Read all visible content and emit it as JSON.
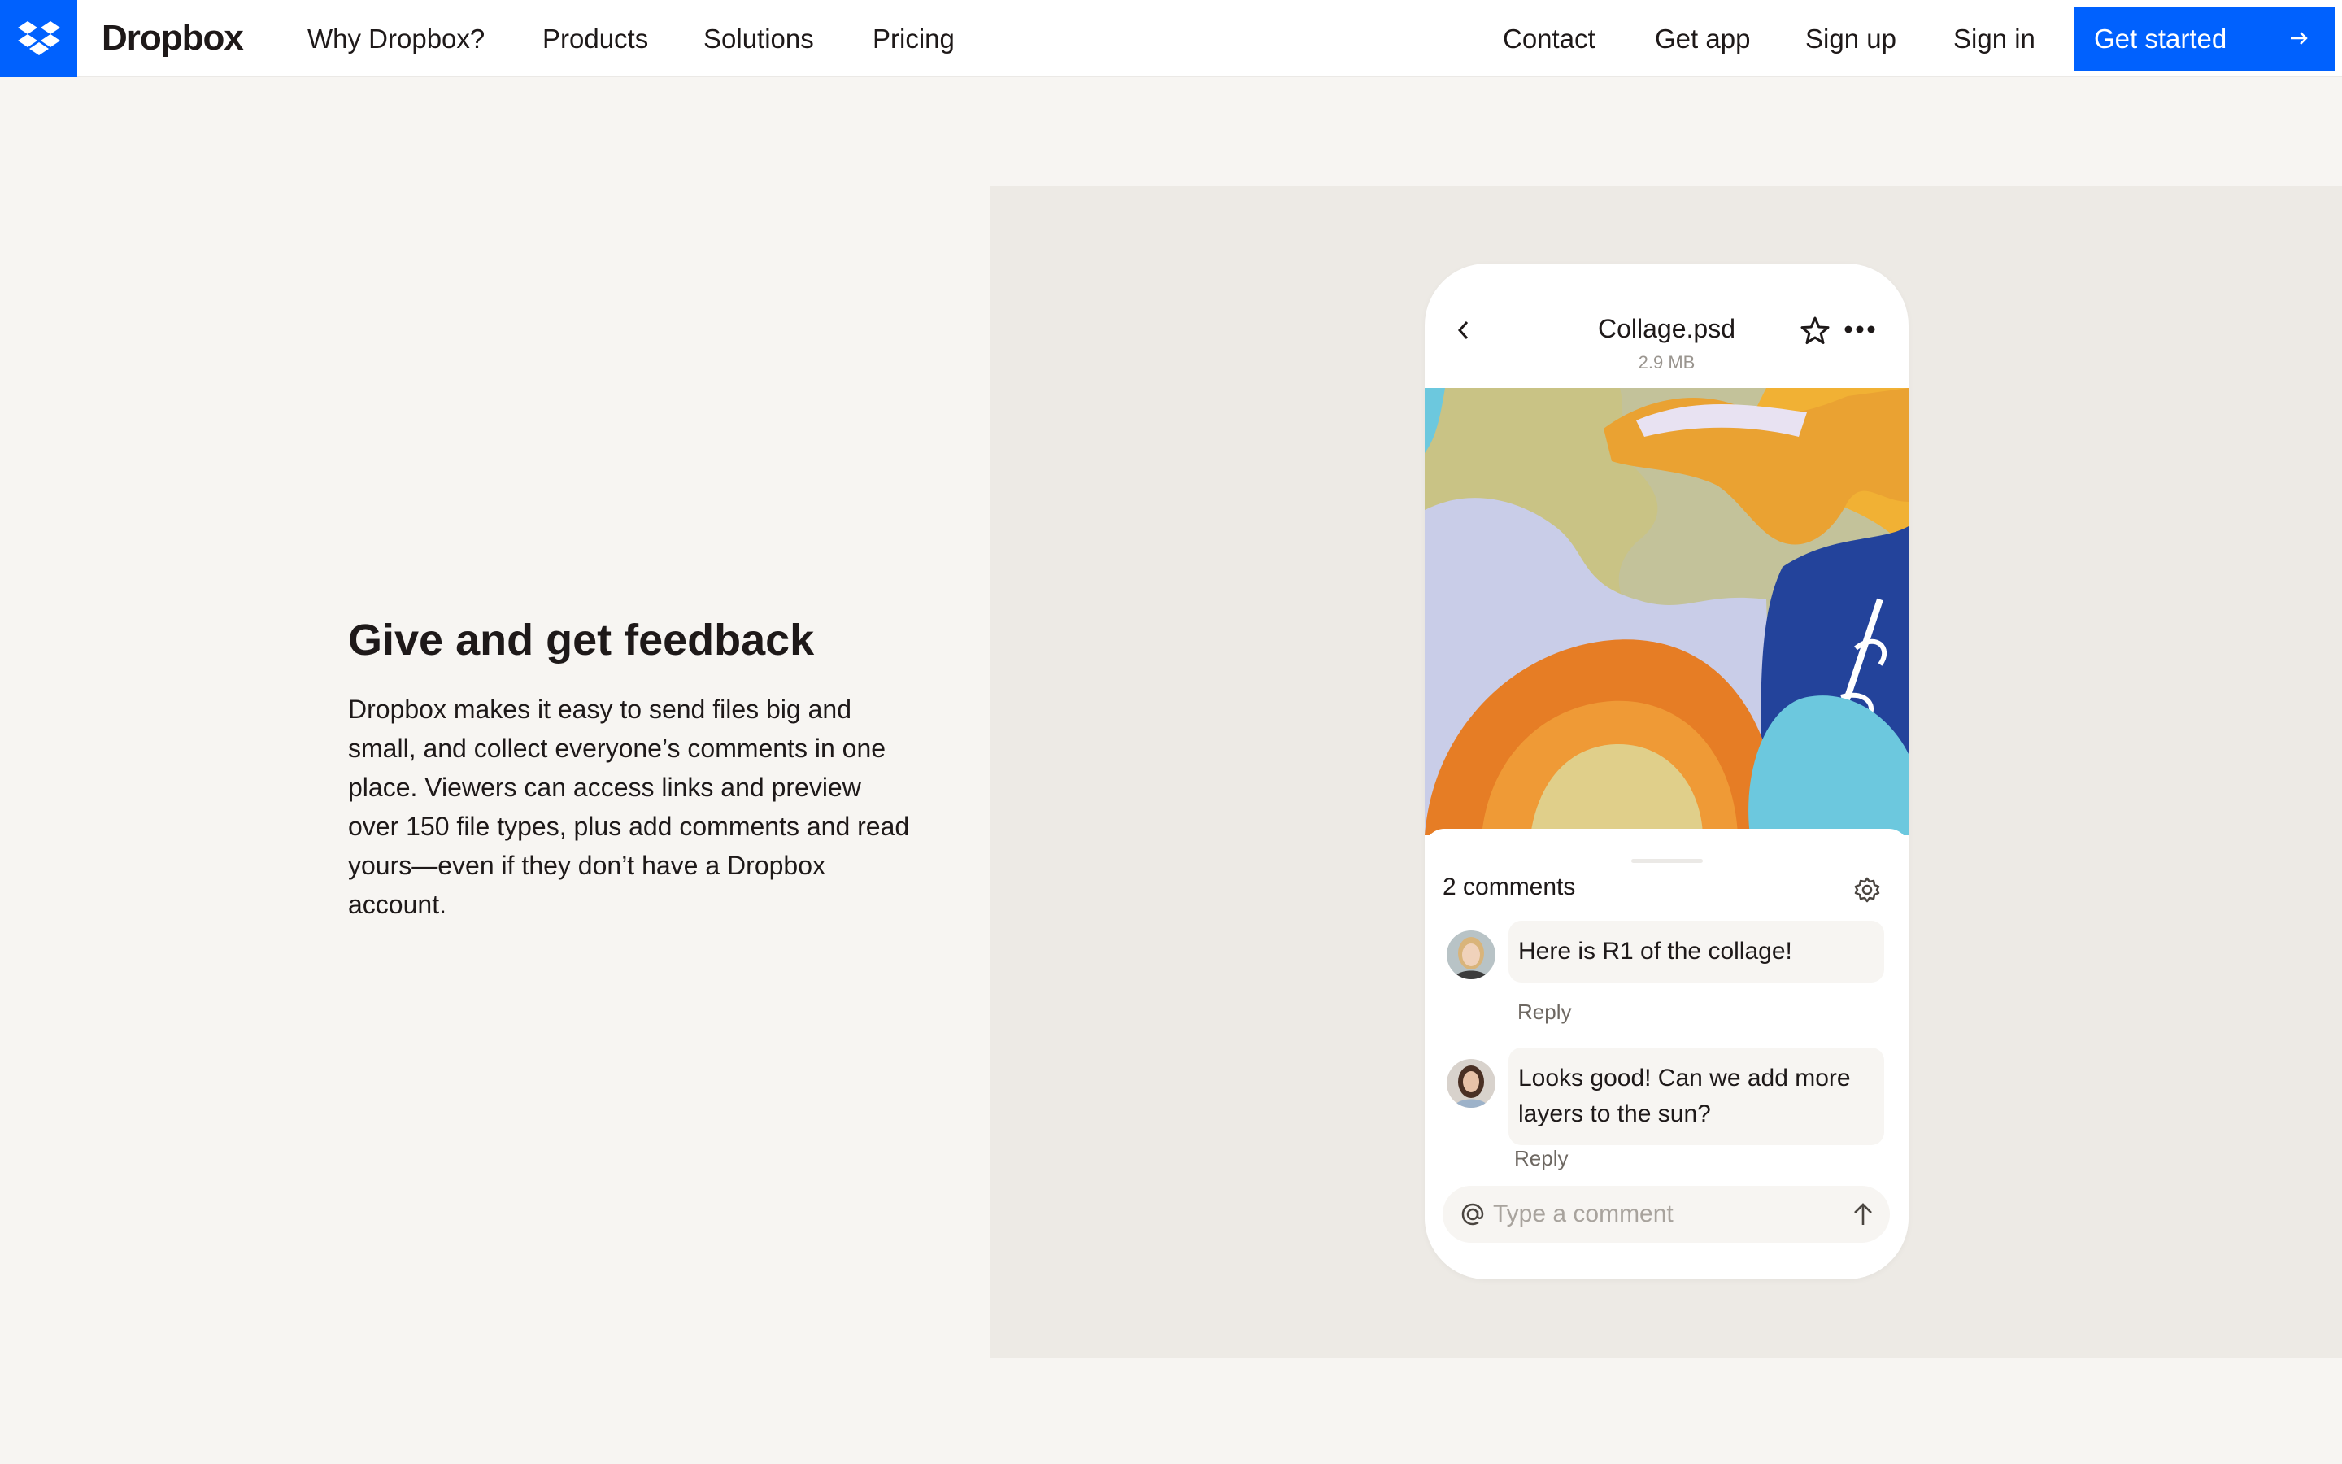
{
  "nav": {
    "brand": "Dropbox",
    "links_left": [
      "Why Dropbox?",
      "Products",
      "Solutions",
      "Pricing"
    ],
    "links_right": [
      "Contact",
      "Get app",
      "Sign up",
      "Sign in"
    ],
    "cta_label": "Get started",
    "logo_color": "#0061fe"
  },
  "feature": {
    "headline": "Give and get feedback",
    "body": "Dropbox makes it easy to send files big and small, and collect everyone’s comments in one place. Viewers can access links and preview over 150 file types, plus add comments and read yours—even if they don’t have a Dropbox account."
  },
  "phone": {
    "file_name": "Collage.psd",
    "file_size": "2.9 MB",
    "comments_count": "2 comments",
    "comments": [
      {
        "text": "Here is R1 of the collage!",
        "reply": "Reply"
      },
      {
        "text": "Looks good! Can we add more layers to the sun?",
        "reply": "Reply"
      }
    ],
    "input_placeholder": "Type a comment"
  },
  "colors": {
    "accent": "#0061fe",
    "page_bg": "#f7f5f2",
    "panel_bg": "#edeae5"
  }
}
